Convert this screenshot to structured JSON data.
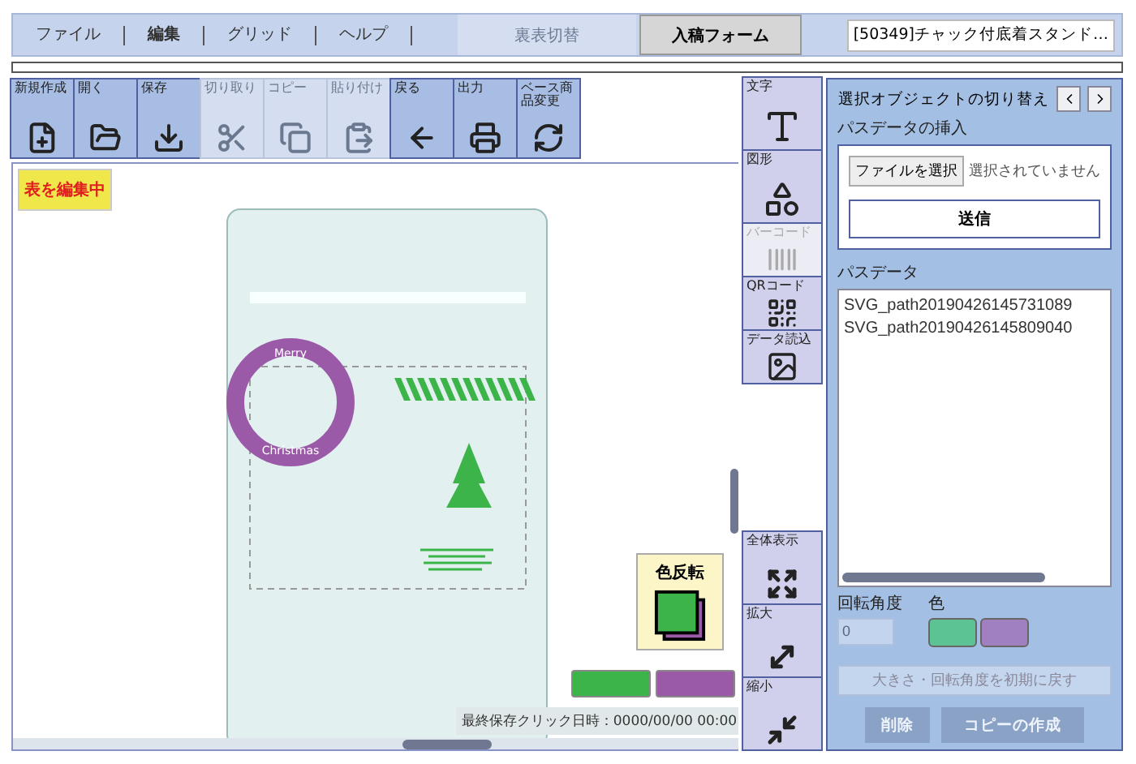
{
  "menu": [
    {
      "label": "ファイル",
      "bold": false
    },
    {
      "label": "編集",
      "bold": true
    },
    {
      "label": "グリッド",
      "bold": false
    },
    {
      "label": "ヘルプ",
      "bold": false
    }
  ],
  "side_toggle": {
    "label": "裏表切替",
    "disabled": true
  },
  "submit_button": {
    "label": "入稿フォーム"
  },
  "product_field": {
    "value": "[50349]チャック付底着スタンド…"
  },
  "toolbar": [
    {
      "label": "新規作成",
      "disabled": false
    },
    {
      "label": "開く",
      "disabled": false
    },
    {
      "label": "保存",
      "disabled": false
    },
    {
      "label": "切り取り",
      "disabled": true
    },
    {
      "label": "コピー",
      "disabled": true
    },
    {
      "label": "貼り付け",
      "disabled": true
    },
    {
      "label": "戻る",
      "disabled": false
    },
    {
      "label": "出力",
      "disabled": false
    },
    {
      "label": "ベース商品変更",
      "disabled": false
    }
  ],
  "canvas": {
    "edit_badge": "表を編集中",
    "design_texts": [
      "Merry",
      "Christmas"
    ],
    "color_invert": {
      "label": "色反転"
    },
    "swatches": [
      {
        "color": "#3cb44a"
      },
      {
        "color": "#9a5aa8"
      }
    ],
    "last_saved": "最終保存クリック日時：0000/00/00 00:00"
  },
  "tools": [
    {
      "label": "文字",
      "disabled": false
    },
    {
      "label": "図形",
      "disabled": false
    },
    {
      "label": "バーコード",
      "disabled": true
    },
    {
      "label": "QRコード",
      "disabled": false
    },
    {
      "label": "データ読込",
      "disabled": false
    }
  ],
  "view_tools": [
    {
      "label": "全体表示"
    },
    {
      "label": "拡大"
    },
    {
      "label": "縮小"
    }
  ],
  "panel": {
    "title": "選択オブジェクトの切り替え",
    "path_insert": {
      "heading": "パスデータの挿入",
      "file_button": "ファイルを選択",
      "file_status": "選択されていません",
      "send_button": "送信"
    },
    "path_data": {
      "heading": "パスデータ",
      "items": [
        {
          "label": "SVG_path20190426145731089",
          "selected": false
        },
        {
          "label": "SVG_path20190426145809040",
          "selected": false
        }
      ]
    },
    "rotation": {
      "label": "回転角度",
      "value": "0",
      "disabled": true
    },
    "color": {
      "label": "色",
      "swatches": [
        {
          "color": "#5bc394"
        },
        {
          "color": "#a080c0"
        }
      ]
    },
    "reset_button": {
      "label": "大きさ・回転角度を初期に戻す",
      "disabled": true
    },
    "actions": [
      {
        "label": "削除",
        "disabled": true
      },
      {
        "label": "コピーの作成",
        "disabled": true
      }
    ]
  }
}
